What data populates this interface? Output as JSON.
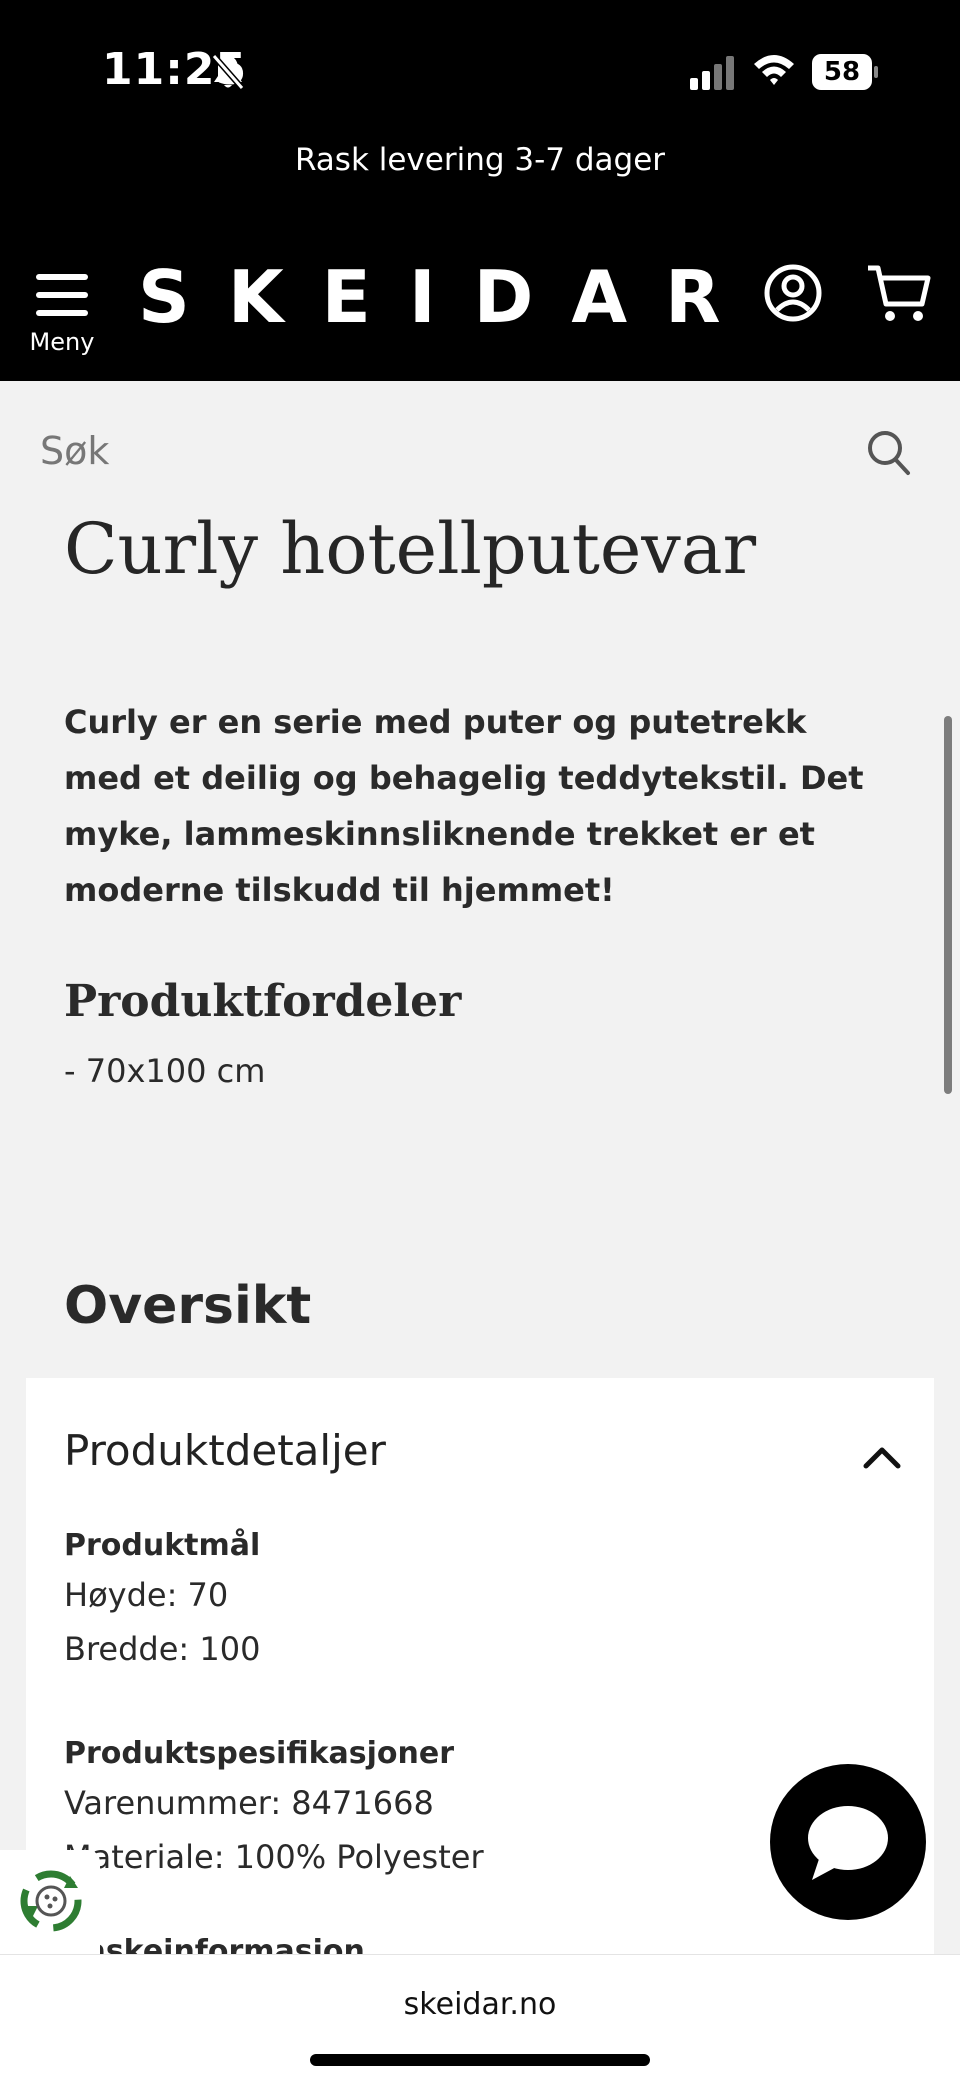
{
  "status_bar": {
    "time": "11:25",
    "battery": "58"
  },
  "header": {
    "promo": "Rask levering 3-7 dager",
    "menu_label": "Meny",
    "logo": "SKEIDAR"
  },
  "search": {
    "placeholder": "Søk"
  },
  "product": {
    "title": "Curly hotellputevar",
    "description": "Curly er en serie med puter og putetrekk med et deilig og behagelig teddytekstil. Det myke, lammeskinnsliknende trekket er et moderne tilskudd til hjemmet!",
    "benefits_title": "Produktfordeler",
    "benefits": [
      "- 70x100 cm"
    ]
  },
  "overview": {
    "title": "Oversikt",
    "details_title": "Produktdetaljer",
    "groups": [
      {
        "title": "Produktmål",
        "rows": [
          "Høyde: 70",
          "Bredde: 100"
        ]
      },
      {
        "title": "Produktspesifikasjoner",
        "rows": [
          "Varenummer: 8471668",
          "Materiale: 100% Polyester"
        ]
      }
    ],
    "next_group_partial": "Vaskeinformasjon"
  },
  "browser": {
    "domain": "skeidar.no"
  },
  "colors": {
    "header_bg": "#000000",
    "page_bg": "#f2f2f2",
    "card_bg": "#ffffff",
    "badge_green": "#2e7d32"
  },
  "icons": [
    "bell-slash-icon",
    "signal-icon",
    "wifi-icon",
    "battery-icon",
    "hamburger-icon",
    "account-icon",
    "cart-icon",
    "search-icon",
    "chevron-up-icon",
    "chat-icon",
    "recycle-icon"
  ]
}
